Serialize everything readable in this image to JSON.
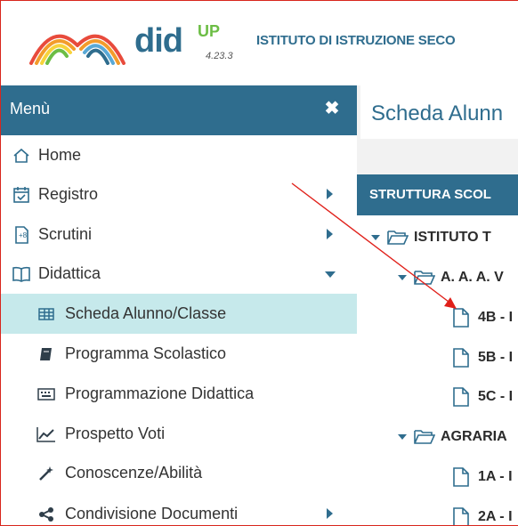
{
  "header": {
    "logo_did": "did",
    "logo_up": "UP",
    "version": "4.23.3",
    "institute": "ISTITUTO DI ISTRUZIONE SECO"
  },
  "sidebar": {
    "title": "Menù",
    "close_icon": "close-icon",
    "items": [
      {
        "label": "Home",
        "icon": "home-icon"
      },
      {
        "label": "Registro",
        "icon": "calendar-icon"
      },
      {
        "label": "Scrutini",
        "icon": "document-icon"
      },
      {
        "label": "Didattica",
        "icon": "book-open-icon"
      },
      {
        "label": "Scheda Alunno/Classe",
        "icon": "table-icon"
      },
      {
        "label": "Programma Scolastico",
        "icon": "book-icon"
      },
      {
        "label": "Programmazione Didattica",
        "icon": "keyboard-icon"
      },
      {
        "label": "Prospetto Voti",
        "icon": "chart-line-icon"
      },
      {
        "label": "Conoscenze/Abilità",
        "icon": "magic-wand-icon"
      },
      {
        "label": "Condivisione Documenti",
        "icon": "share-icon"
      }
    ]
  },
  "main": {
    "page_title": "Scheda Alunn",
    "panel_title": "STRUTTURA SCOL",
    "tree": [
      {
        "label": "ISTITUTO T"
      },
      {
        "label": "A. A. A. V"
      },
      {
        "label": "4B - I"
      },
      {
        "label": "5B - I"
      },
      {
        "label": "5C - I"
      },
      {
        "label": "AGRARIA"
      },
      {
        "label": "1A - I"
      },
      {
        "label": "2A - I"
      }
    ]
  },
  "colors": {
    "brand": "#2f6d8e",
    "active_bg": "#c6e9eb",
    "annotation_arrow": "#e0201a"
  }
}
